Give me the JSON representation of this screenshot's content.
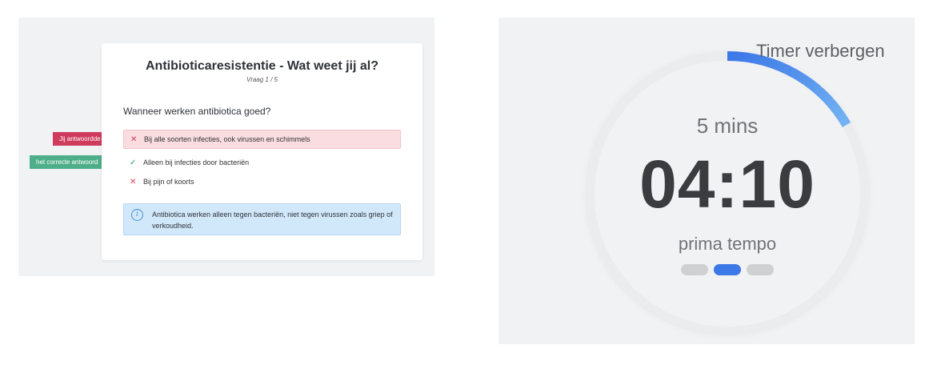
{
  "quiz": {
    "title": "Antibioticaresistentie - Wat weet jij al?",
    "progress": "Vraag 1 / 5",
    "question": "Wanneer werken antibiotica goed?",
    "options": [
      {
        "label": "Bij alle soorten infecties, ook virussen en schimmels",
        "mark": "✕",
        "state": "selected-wrong"
      },
      {
        "label": "Alleen bij infecties door bacteriën",
        "mark": "✓",
        "state": "correct"
      },
      {
        "label": "Bij pijn of koorts",
        "mark": "✕",
        "state": "wrong"
      }
    ],
    "info": "Antibiotica werken alleen tegen bacteriën, niet tegen virussen zoals griep of verkoudheid.",
    "tags": {
      "you_answered": "Jij antwoordde",
      "correct_answer": "het correcte antwoord"
    }
  },
  "timer": {
    "hide_label": "Timer verbergen",
    "duration": "5 mins",
    "time": "04:10",
    "pace": "prima tempo",
    "pace_steps": 3,
    "pace_active_index": 1,
    "remaining_fraction": 0.1667,
    "accent_color": "#3c78e8"
  }
}
